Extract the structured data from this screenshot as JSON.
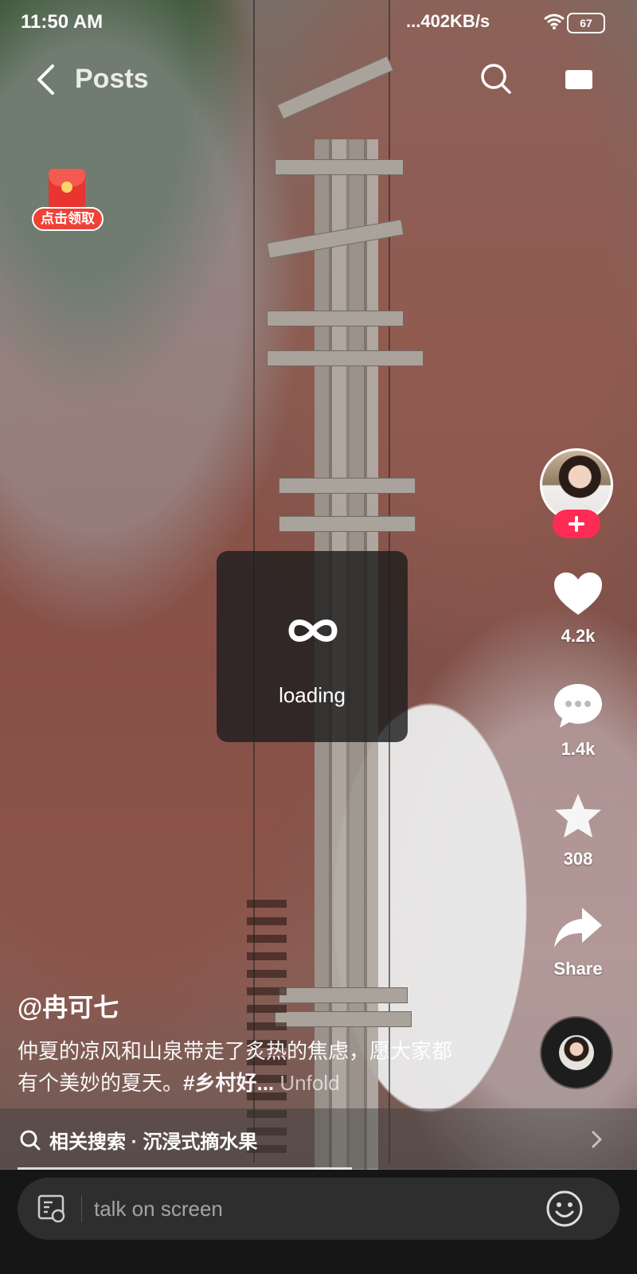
{
  "status_bar": {
    "time": "11:50 AM",
    "network_speed": "...402KB/s",
    "battery": "67"
  },
  "header": {
    "title": "Posts"
  },
  "red_envelope": {
    "label": "点击领取"
  },
  "loading": {
    "text": "loading"
  },
  "actions": {
    "like_count": "4.2k",
    "comment_count": "1.4k",
    "favorite_count": "308",
    "share_label": "Share"
  },
  "post": {
    "username": "@冉可七",
    "description": "仲夏的凉风和山泉带走了炙热的焦虑，愿大家都有个美妙的夏天。",
    "hashtag": "#乡村好...",
    "unfold": "Unfold"
  },
  "related_search": {
    "label": "相关搜索 · 沉浸式摘水果"
  },
  "comment_bar": {
    "placeholder": "talk on screen"
  },
  "colors": {
    "follow_accent": "#fe2c55",
    "envelope_red": "#e9352f"
  },
  "icons": [
    "back-icon",
    "search-icon",
    "cast-icon",
    "wifi-icon",
    "battery-icon",
    "infinity-loading-icon",
    "heart-icon",
    "comment-icon",
    "star-icon",
    "share-icon",
    "danmaku-icon",
    "emoji-icon",
    "chevron-right-icon"
  ]
}
